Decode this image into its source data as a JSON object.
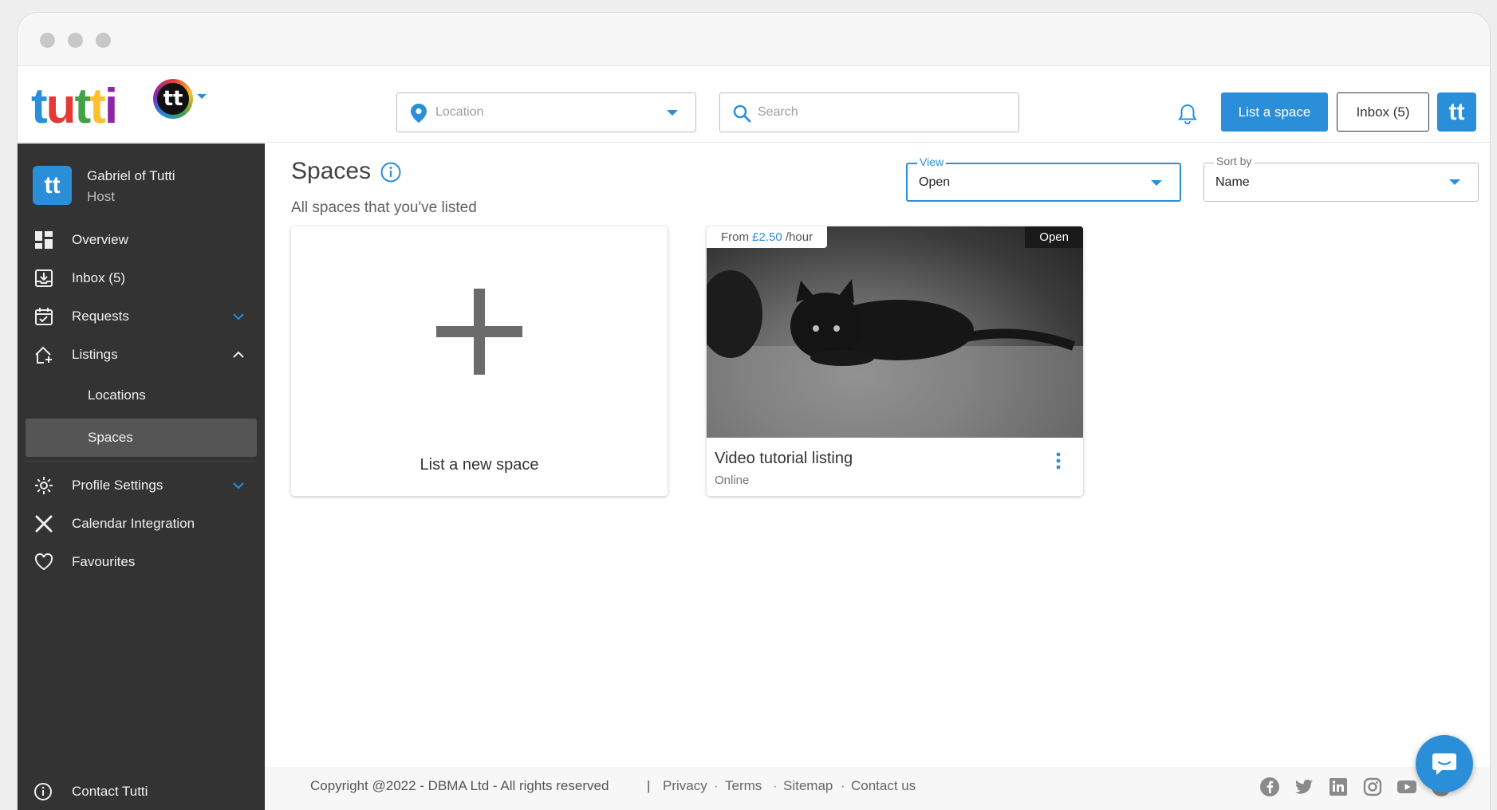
{
  "brand": {
    "logo_letters": [
      "t",
      "u",
      "t",
      "t",
      "i"
    ],
    "logo_colors": [
      "#2a8fd8",
      "#e53935",
      "#43a047",
      "#fbc02d",
      "#8e24aa"
    ],
    "badge_letter": "tt",
    "accent": "#2a8fd8"
  },
  "header": {
    "location_placeholder": "Location",
    "search_placeholder": "Search",
    "list_space_label": "List a space",
    "inbox_label": "Inbox (5)"
  },
  "user": {
    "name": "Gabriel of Tutti",
    "role": "Host",
    "avatar_letter": "tt"
  },
  "sidebar": {
    "items": [
      {
        "label": "Overview",
        "icon": "dashboard-icon"
      },
      {
        "label": "Inbox (5)",
        "icon": "inbox-icon"
      },
      {
        "label": "Requests",
        "icon": "calendar-check-icon"
      },
      {
        "label": "Listings",
        "icon": "house-plus-icon"
      },
      {
        "label": "Profile Settings",
        "icon": "gear-icon"
      },
      {
        "label": "Calendar Integration",
        "icon": "tools-icon"
      },
      {
        "label": "Favourites",
        "icon": "heart-icon"
      }
    ],
    "sub_items": [
      {
        "label": "Locations"
      },
      {
        "label": "Spaces"
      }
    ],
    "contact_label": "Contact Tutti"
  },
  "main": {
    "title": "Spaces",
    "subtitle": "All spaces that you've listed",
    "view": {
      "legend": "View",
      "value": "Open"
    },
    "sort": {
      "legend": "Sort by",
      "value": "Name"
    },
    "new_space_label": "List a new space",
    "listing": {
      "price_prefix": "From",
      "price_amount": "£2.50",
      "price_unit": "/hour",
      "status": "Open",
      "title": "Video tutorial listing",
      "subtitle": "Online"
    }
  },
  "footer": {
    "copyright": "Copyright @2022 - DBMA Ltd - All rights reserved",
    "separator": "|",
    "links": [
      "Privacy",
      "Terms",
      "Sitemap",
      "Contact us"
    ],
    "social_icons": [
      "facebook-icon",
      "twitter-icon",
      "linkedin-icon",
      "instagram-icon",
      "youtube-icon",
      "reddit-icon"
    ]
  }
}
